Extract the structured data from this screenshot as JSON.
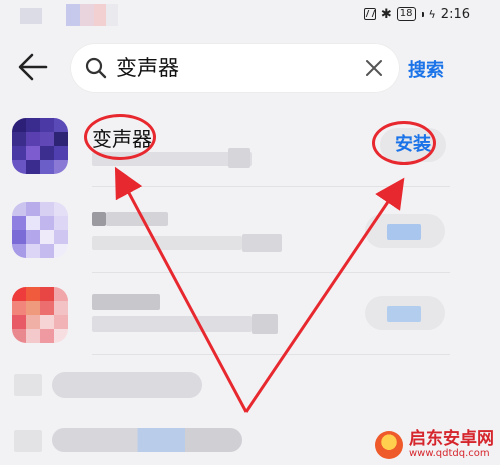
{
  "status_bar": {
    "battery": "18",
    "time": "2:16"
  },
  "header": {
    "search_query": "变声器",
    "search_button": "搜索"
  },
  "results": [
    {
      "name": "变声器",
      "action": "安装"
    }
  ],
  "watermark": {
    "title": "启东安卓网",
    "url": "www.qdtdq.com"
  },
  "colors": {
    "accent": "#1a73e8",
    "annotation": "#e8282f"
  }
}
